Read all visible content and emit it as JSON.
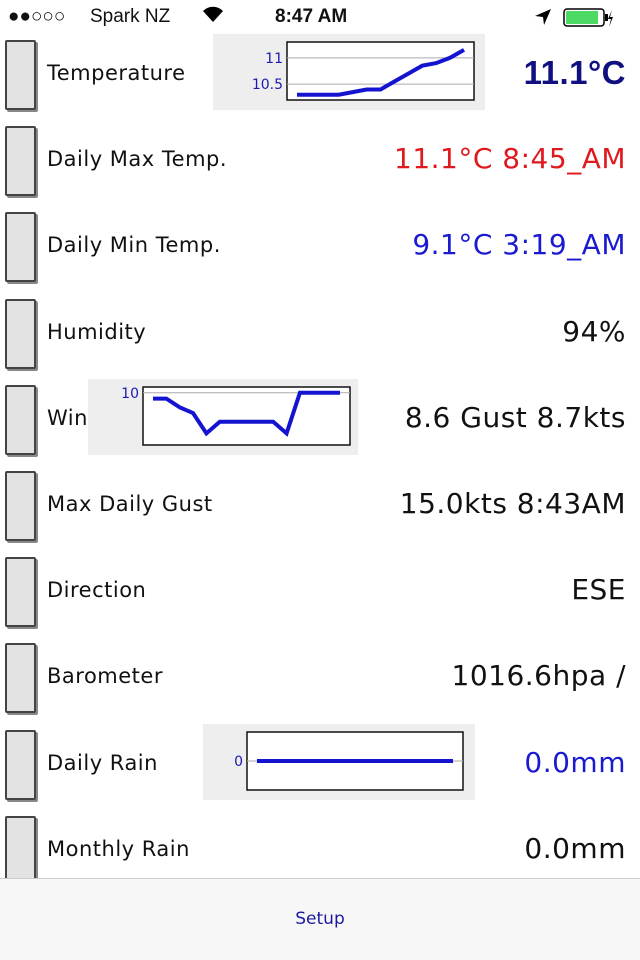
{
  "status_bar": {
    "signal": "●●○○○",
    "carrier": "Spark NZ",
    "time": "8:47 AM",
    "battery_color": "#4cd964"
  },
  "rows": [
    {
      "label": "Temperature",
      "value": "11.1°C",
      "color": "#101080",
      "bold": true,
      "chart": {
        "y_ticks": [
          "11",
          "10.5"
        ],
        "values": [
          10.3,
          10.3,
          10.3,
          10.3,
          10.35,
          10.4,
          10.4,
          10.55,
          10.7,
          10.85,
          10.9,
          11.0,
          11.15
        ],
        "ylim": [
          10.2,
          11.3
        ]
      }
    },
    {
      "label": "Daily Max Temp.",
      "value": "11.1°C 8:45_AM",
      "color": "#e0191e"
    },
    {
      "label": "Daily Min Temp.",
      "value": "9.1°C 3:19_AM",
      "color": "#1a1ad0"
    },
    {
      "label": "Humidity",
      "value": "94%",
      "color": "#111111"
    },
    {
      "label": "Wind",
      "value": "8.6 Gust 8.7kts",
      "color": "#111111",
      "chart": {
        "y_ticks": [
          "10"
        ],
        "values": [
          9.8,
          9.8,
          9.5,
          9.3,
          8.6,
          9.0,
          9.0,
          9.0,
          9.0,
          9.0,
          8.6,
          10.0,
          10.0,
          10.0,
          10.0
        ],
        "ylim": [
          8.2,
          10.2
        ]
      }
    },
    {
      "label": "Max Daily Gust",
      "value": "15.0kts 8:43AM",
      "color": "#111111"
    },
    {
      "label": "Direction",
      "value": "ESE",
      "color": "#111111"
    },
    {
      "label": "Barometer",
      "value": "1016.6hpa /",
      "color": "#111111"
    },
    {
      "label": "Daily Rain",
      "value": "0.0mm",
      "color": "#1a1ad0",
      "chart": {
        "y_ticks": [
          "0"
        ],
        "values": [
          0,
          0,
          0,
          0,
          0
        ],
        "ylim": [
          -1,
          1
        ]
      }
    },
    {
      "label": "Monthly Rain",
      "value": "0.0mm",
      "color": "#111111"
    }
  ],
  "footer": {
    "setup_label": "Setup"
  }
}
